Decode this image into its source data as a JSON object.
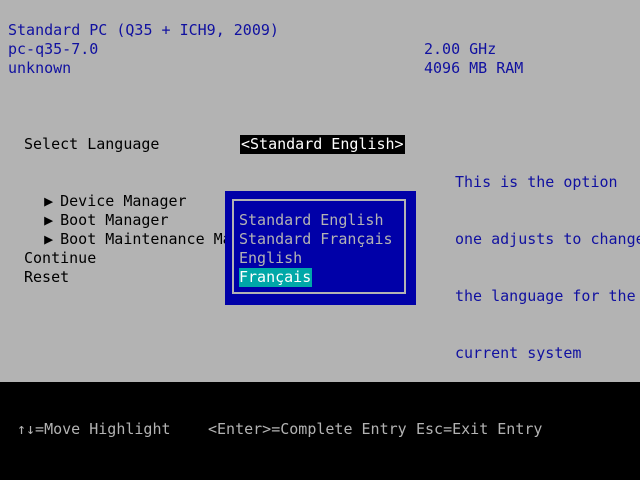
{
  "system_info": {
    "machine": "Standard PC (Q35 + ICH9, 2009)",
    "version": "pc-q35-7.0",
    "id": "unknown",
    "cpu_speed": "2.00 GHz",
    "memory": "4096 MB RAM"
  },
  "language_setting": {
    "label": "Select Language",
    "value": "<Standard English>"
  },
  "menu": {
    "items": [
      {
        "label": "Device Manager",
        "submenu": true
      },
      {
        "label": "Boot Manager",
        "submenu": true
      },
      {
        "label": "Boot Maintenance Manager",
        "submenu": true
      }
    ],
    "actions": [
      {
        "label": "Continue"
      },
      {
        "label": "Reset"
      }
    ]
  },
  "help": {
    "lines": [
      "This is the option",
      "one adjusts to change",
      "the language for the",
      "current system"
    ]
  },
  "language_popup": {
    "options": [
      {
        "label": "Standard English",
        "selected": false
      },
      {
        "label": "Standard Français",
        "selected": false
      },
      {
        "label": "English",
        "selected": false
      },
      {
        "label": "Français",
        "selected": true
      }
    ]
  },
  "footer": {
    "move_hint": "↑↓=Move Highlight",
    "enter_hint": "<Enter>=Complete Entry",
    "esc_hint": "Esc=Exit Entry"
  },
  "colors": {
    "background": "#b3b3b3",
    "text_blue": "#1010a0",
    "popup_background": "#0000a8",
    "popup_highlight": "#00a8a8",
    "footer_background": "#000000"
  }
}
